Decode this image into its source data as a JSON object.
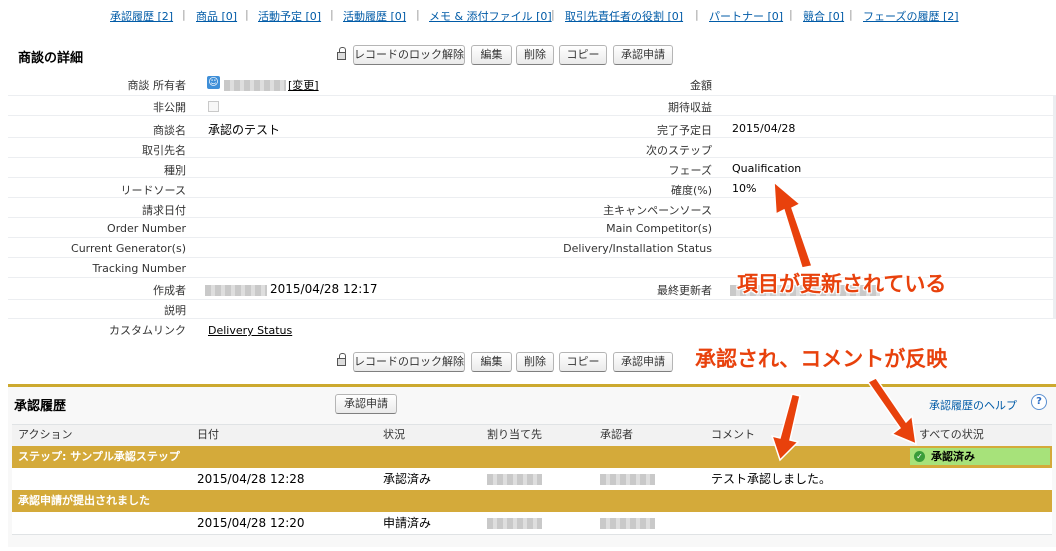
{
  "related_links": [
    "承認履歴 [2]",
    "商品 [0]",
    "活動予定 [0]",
    "活動履歴 [0]",
    "メモ & 添付ファイル [0]",
    "取引先責任者の役割 [0]",
    "パートナー [0]",
    "競合 [0]",
    "フェーズの履歴 [2]"
  ],
  "detail": {
    "title": "商談の詳細",
    "buttons": {
      "unlock": "レコードのロック解除",
      "edit": "編集",
      "delete": "削除",
      "copy": "コピー",
      "submit": "承認申請"
    },
    "left_labels": [
      "商談 所有者",
      "非公開",
      "商談名",
      "取引先名",
      "種別",
      "リードソース",
      "請求日付",
      "Order Number",
      "Current Generator(s)",
      "Tracking Number",
      "作成者",
      "説明",
      "カスタムリンク"
    ],
    "right_labels": [
      "金額",
      "期待収益",
      "完了予定日",
      "次のステップ",
      "フェーズ",
      "確度(%)",
      "主キャンペーンソース",
      "Main Competitor(s)",
      "Delivery/Installation Status",
      "最終更新者"
    ],
    "owner_change": "[変更]",
    "opportunity_name": "承認のテスト",
    "close_date": "2015/04/28",
    "stage": "Qualification",
    "probability": "10%",
    "created_date": "2015/04/28 12:17",
    "custom_link": "Delivery Status"
  },
  "annotations": {
    "updated": "項目が更新されている",
    "approved": "承認され、コメントが反映"
  },
  "approval_history": {
    "title": "承認履歴",
    "submit_button": "承認申請",
    "help_link": "承認履歴のヘルプ",
    "help_icon": "?",
    "columns": [
      "アクション",
      "日付",
      "状況",
      "割り当て先",
      "承認者",
      "コメント",
      "すべての状況"
    ],
    "step1": {
      "label": "ステップ: サンプル承認ステップ",
      "overall_status": "承認済み",
      "date": "2015/04/28 12:28",
      "status": "承認済み",
      "comment": "テスト承認しました。"
    },
    "step2": {
      "label": "承認申請が提出されました",
      "date": "2015/04/28 12:20",
      "status": "申請済み"
    }
  },
  "colors": {
    "accent": "#cca92f",
    "step_band": "#d4aa3a",
    "annotation": "#e8410c",
    "approved_badge": "#a7e27a"
  }
}
